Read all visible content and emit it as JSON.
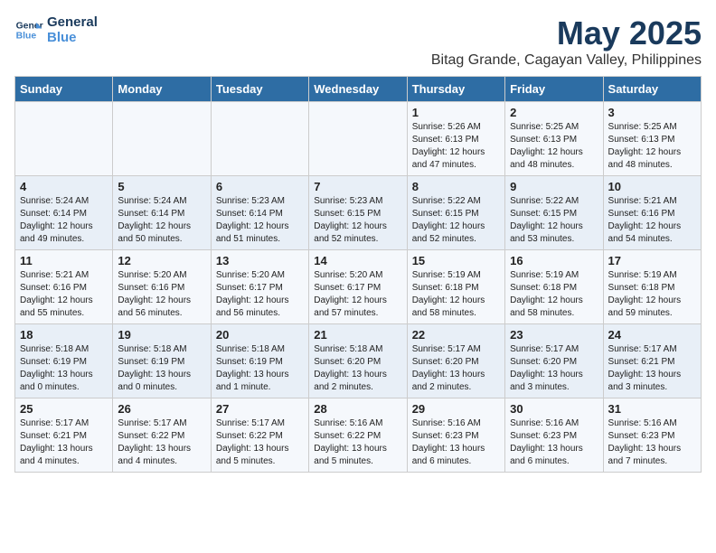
{
  "header": {
    "logo_line1": "General",
    "logo_line2": "Blue",
    "title": "May 2025",
    "subtitle": "Bitag Grande, Cagayan Valley, Philippines"
  },
  "weekdays": [
    "Sunday",
    "Monday",
    "Tuesday",
    "Wednesday",
    "Thursday",
    "Friday",
    "Saturday"
  ],
  "weeks": [
    [
      {
        "day": "",
        "info": ""
      },
      {
        "day": "",
        "info": ""
      },
      {
        "day": "",
        "info": ""
      },
      {
        "day": "",
        "info": ""
      },
      {
        "day": "1",
        "info": "Sunrise: 5:26 AM\nSunset: 6:13 PM\nDaylight: 12 hours\nand 47 minutes."
      },
      {
        "day": "2",
        "info": "Sunrise: 5:25 AM\nSunset: 6:13 PM\nDaylight: 12 hours\nand 48 minutes."
      },
      {
        "day": "3",
        "info": "Sunrise: 5:25 AM\nSunset: 6:13 PM\nDaylight: 12 hours\nand 48 minutes."
      }
    ],
    [
      {
        "day": "4",
        "info": "Sunrise: 5:24 AM\nSunset: 6:14 PM\nDaylight: 12 hours\nand 49 minutes."
      },
      {
        "day": "5",
        "info": "Sunrise: 5:24 AM\nSunset: 6:14 PM\nDaylight: 12 hours\nand 50 minutes."
      },
      {
        "day": "6",
        "info": "Sunrise: 5:23 AM\nSunset: 6:14 PM\nDaylight: 12 hours\nand 51 minutes."
      },
      {
        "day": "7",
        "info": "Sunrise: 5:23 AM\nSunset: 6:15 PM\nDaylight: 12 hours\nand 52 minutes."
      },
      {
        "day": "8",
        "info": "Sunrise: 5:22 AM\nSunset: 6:15 PM\nDaylight: 12 hours\nand 52 minutes."
      },
      {
        "day": "9",
        "info": "Sunrise: 5:22 AM\nSunset: 6:15 PM\nDaylight: 12 hours\nand 53 minutes."
      },
      {
        "day": "10",
        "info": "Sunrise: 5:21 AM\nSunset: 6:16 PM\nDaylight: 12 hours\nand 54 minutes."
      }
    ],
    [
      {
        "day": "11",
        "info": "Sunrise: 5:21 AM\nSunset: 6:16 PM\nDaylight: 12 hours\nand 55 minutes."
      },
      {
        "day": "12",
        "info": "Sunrise: 5:20 AM\nSunset: 6:16 PM\nDaylight: 12 hours\nand 56 minutes."
      },
      {
        "day": "13",
        "info": "Sunrise: 5:20 AM\nSunset: 6:17 PM\nDaylight: 12 hours\nand 56 minutes."
      },
      {
        "day": "14",
        "info": "Sunrise: 5:20 AM\nSunset: 6:17 PM\nDaylight: 12 hours\nand 57 minutes."
      },
      {
        "day": "15",
        "info": "Sunrise: 5:19 AM\nSunset: 6:18 PM\nDaylight: 12 hours\nand 58 minutes."
      },
      {
        "day": "16",
        "info": "Sunrise: 5:19 AM\nSunset: 6:18 PM\nDaylight: 12 hours\nand 58 minutes."
      },
      {
        "day": "17",
        "info": "Sunrise: 5:19 AM\nSunset: 6:18 PM\nDaylight: 12 hours\nand 59 minutes."
      }
    ],
    [
      {
        "day": "18",
        "info": "Sunrise: 5:18 AM\nSunset: 6:19 PM\nDaylight: 13 hours\nand 0 minutes."
      },
      {
        "day": "19",
        "info": "Sunrise: 5:18 AM\nSunset: 6:19 PM\nDaylight: 13 hours\nand 0 minutes."
      },
      {
        "day": "20",
        "info": "Sunrise: 5:18 AM\nSunset: 6:19 PM\nDaylight: 13 hours\nand 1 minute."
      },
      {
        "day": "21",
        "info": "Sunrise: 5:18 AM\nSunset: 6:20 PM\nDaylight: 13 hours\nand 2 minutes."
      },
      {
        "day": "22",
        "info": "Sunrise: 5:17 AM\nSunset: 6:20 PM\nDaylight: 13 hours\nand 2 minutes."
      },
      {
        "day": "23",
        "info": "Sunrise: 5:17 AM\nSunset: 6:20 PM\nDaylight: 13 hours\nand 3 minutes."
      },
      {
        "day": "24",
        "info": "Sunrise: 5:17 AM\nSunset: 6:21 PM\nDaylight: 13 hours\nand 3 minutes."
      }
    ],
    [
      {
        "day": "25",
        "info": "Sunrise: 5:17 AM\nSunset: 6:21 PM\nDaylight: 13 hours\nand 4 minutes."
      },
      {
        "day": "26",
        "info": "Sunrise: 5:17 AM\nSunset: 6:22 PM\nDaylight: 13 hours\nand 4 minutes."
      },
      {
        "day": "27",
        "info": "Sunrise: 5:17 AM\nSunset: 6:22 PM\nDaylight: 13 hours\nand 5 minutes."
      },
      {
        "day": "28",
        "info": "Sunrise: 5:16 AM\nSunset: 6:22 PM\nDaylight: 13 hours\nand 5 minutes."
      },
      {
        "day": "29",
        "info": "Sunrise: 5:16 AM\nSunset: 6:23 PM\nDaylight: 13 hours\nand 6 minutes."
      },
      {
        "day": "30",
        "info": "Sunrise: 5:16 AM\nSunset: 6:23 PM\nDaylight: 13 hours\nand 6 minutes."
      },
      {
        "day": "31",
        "info": "Sunrise: 5:16 AM\nSunset: 6:23 PM\nDaylight: 13 hours\nand 7 minutes."
      }
    ]
  ]
}
